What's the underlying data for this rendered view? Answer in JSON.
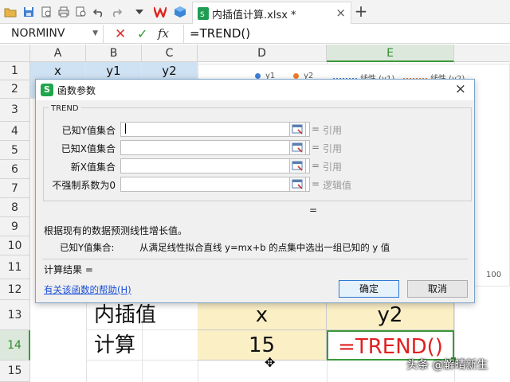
{
  "toolbar": {
    "file_tab_title": "内插值计算.xlsx *",
    "new_tab": "+"
  },
  "formula_bar": {
    "name_box": "NORMINV",
    "fx_label": "fx",
    "formula": "=TREND()"
  },
  "sheet": {
    "columns": [
      "A",
      "B",
      "C",
      "D",
      "E"
    ],
    "selected_column": "E",
    "rows": [
      "1",
      "2",
      "3",
      "4",
      "5",
      "6",
      "7",
      "8",
      "9",
      "10",
      "11",
      "12",
      "13",
      "14",
      "15"
    ],
    "selected_row": "14",
    "row1": {
      "a": "x",
      "b": "y1",
      "c": "y2"
    },
    "row13": {
      "b": "内插值",
      "d": "x",
      "e": "y2"
    },
    "row14": {
      "b": "计算",
      "d": "15",
      "e": "=TREND()"
    }
  },
  "chart": {
    "legend": [
      "y1",
      "y2",
      "线性 (y1)",
      "线性 (y2)"
    ],
    "tick_100": "100",
    "colors": {
      "y1": "#3c7fd6",
      "y2": "#f07a28",
      "linear_y1": "#3c7fd6",
      "linear_y2": "#f07a28"
    }
  },
  "dialog": {
    "title": "函数参数",
    "close": "×",
    "function_name": "TREND",
    "args": [
      {
        "label": "已知Y值集合",
        "value": "",
        "result": "引用"
      },
      {
        "label": "已知X值集合",
        "value": "",
        "result": "引用"
      },
      {
        "label": "新X值集合",
        "value": "",
        "result": "引用"
      },
      {
        "label": "不强制系数为0",
        "value": "",
        "result": "逻辑值"
      }
    ],
    "equals": "=",
    "description": "根据现有的数据预测线性增长值。",
    "arg_help_label": "已知Y值集合:",
    "arg_help_text": "从满足线性拟合直线 y=mx+b 的点集中选出一组已知的 y 值",
    "result_label": "计算结果 =",
    "help_link": "有关该函数的帮助(H)",
    "ok": "确定",
    "cancel": "取消"
  },
  "watermark": "头条 @解晴新生",
  "accent_color": "#2e9a2e"
}
